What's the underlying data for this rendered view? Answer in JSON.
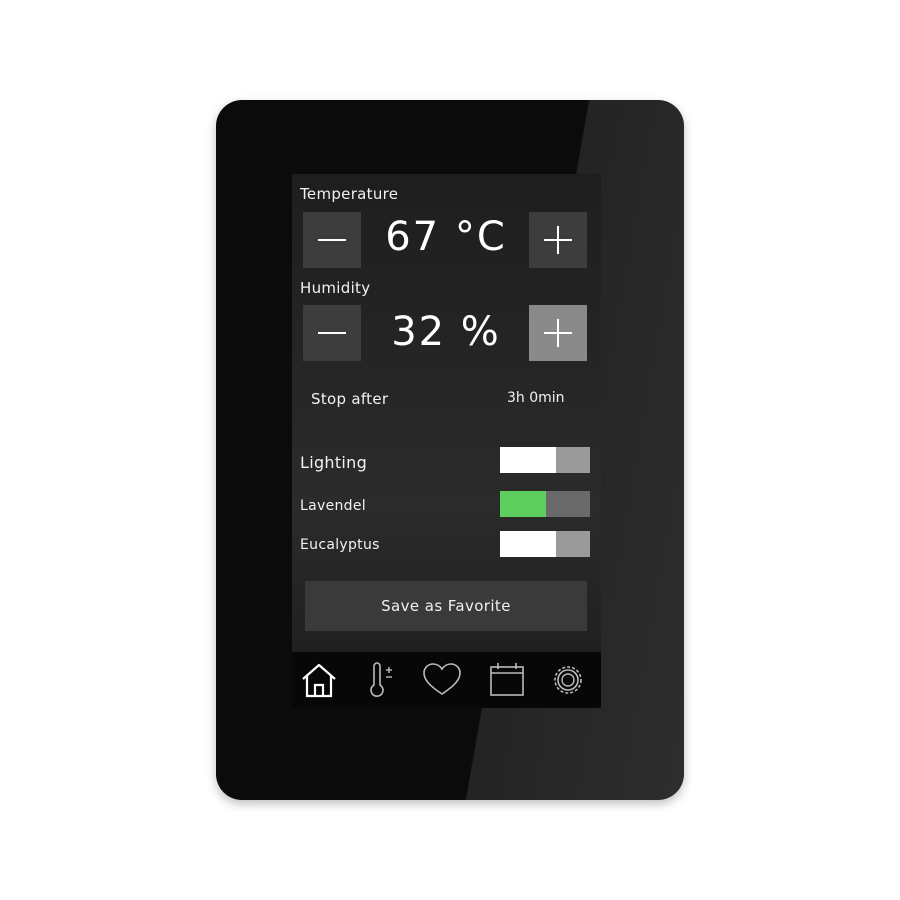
{
  "temperature": {
    "label": "Temperature",
    "value": "67 °C",
    "decrease_icon": "minus-icon",
    "increase_icon": "plus-icon"
  },
  "humidity": {
    "label": "Humidity",
    "value": "32 %",
    "decrease_icon": "minus-icon",
    "increase_icon": "plus-icon"
  },
  "timer": {
    "label": "Stop after",
    "value": "3h 0min"
  },
  "toggles": [
    {
      "label": "Lighting",
      "state": "off"
    },
    {
      "label": "Lavendel",
      "state": "on"
    },
    {
      "label": "Eucalyptus",
      "state": "off"
    }
  ],
  "save_button": {
    "label": "Save as Favorite"
  },
  "nav": {
    "items": [
      {
        "icon": "home-icon",
        "active": true
      },
      {
        "icon": "thermometer-icon",
        "active": false
      },
      {
        "icon": "heart-icon",
        "active": false
      },
      {
        "icon": "calendar-icon",
        "active": false
      },
      {
        "icon": "gear-icon",
        "active": false
      }
    ]
  },
  "colors": {
    "accent_on": "#5ecf5e",
    "screen_bg": "#262626",
    "device_bg": "#0b0b0b"
  }
}
